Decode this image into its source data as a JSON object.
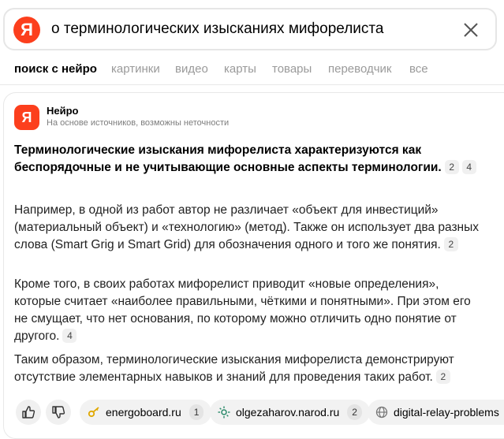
{
  "search": {
    "logo": "Я",
    "query": "о терминологических изысканиях мифорелиста"
  },
  "tabs": [
    {
      "label": "поиск с нейро",
      "active": true
    },
    {
      "label": "картинки"
    },
    {
      "label": "видео"
    },
    {
      "label": "карты"
    },
    {
      "label": "товары"
    },
    {
      "label": "переводчик"
    },
    {
      "label": "все"
    }
  ],
  "neuro": {
    "icon": "Я",
    "name": "Нейро",
    "subtitle": "На основе источников, возможны неточности"
  },
  "answer": {
    "headline": "Терминологические изыскания мифорелиста характеризуются как беспорядочные и не учитывающие основные аспекты терминологии.",
    "headline_refs": [
      "2",
      "4"
    ],
    "p1": "Например, в одной из работ автор не различает «объект для инвестиций» (материальный объект) и «технологию» (метод). Также он использует два разных слова (Smart Grig и Smart Grid) для обозначения одного и того же понятия.",
    "p1_refs": [
      "2"
    ],
    "p2": "Кроме того, в своих работах мифорелист приводит «новые определения», которые считает «наиболее правильными, чёткими и понятными». При этом его не смущает, что нет основания, по которому можно отличить одно понятие от другого.",
    "p2_refs": [
      "4"
    ],
    "p3": "Таким образом, терминологические изыскания мифорелиста демонстрируют отсутствие элементарных навыков и знаний для проведения таких работ.",
    "p3_refs": [
      "2"
    ]
  },
  "sources": [
    {
      "name": "energoboard.ru",
      "count": "1",
      "icon": "key-icon"
    },
    {
      "name": "olgezaharov.narod.ru",
      "count": "2",
      "icon": "sun-icon"
    },
    {
      "name": "digital-relay-problems",
      "count": "",
      "icon": "globe-icon"
    }
  ],
  "colors": {
    "brand": "#fc3f1d",
    "muted": "#9a9a9a"
  }
}
